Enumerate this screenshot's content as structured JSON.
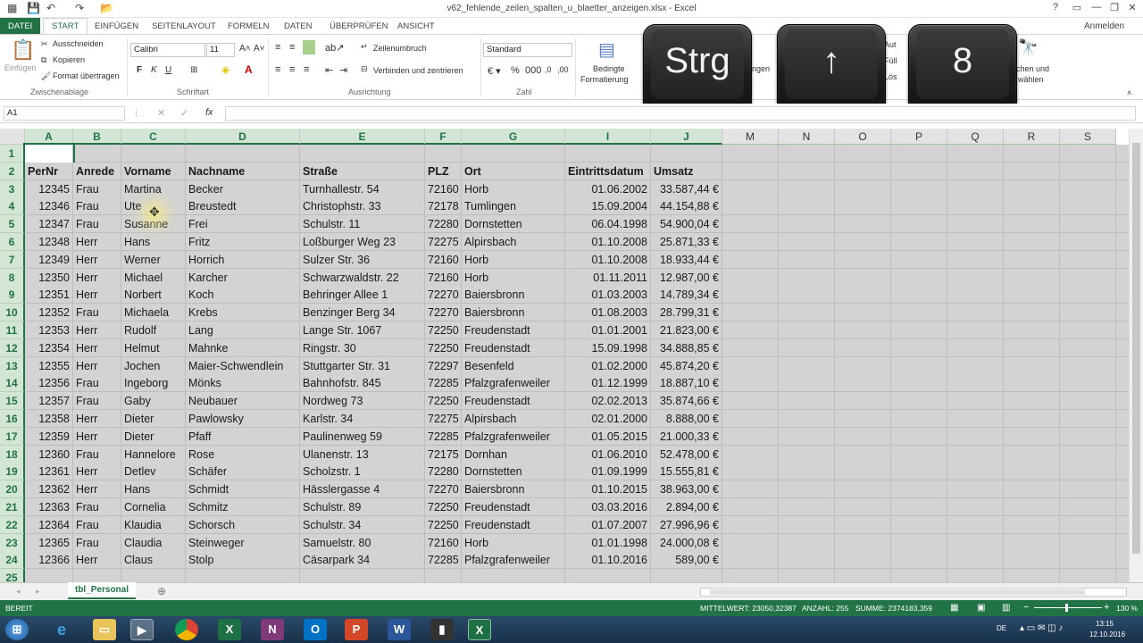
{
  "window": {
    "title": "v62_fehlende_zeilen_spalten_u_blaetter_anzeigen.xlsx - Excel",
    "user": "Anmelden",
    "help": "?",
    "minimize": "—",
    "restore": "❐",
    "close": "✕"
  },
  "tabs": [
    "DATEI",
    "START",
    "EINFÜGEN",
    "SEITENLAYOUT",
    "FORMELN",
    "DATEN",
    "ÜBERPRÜFEN",
    "ANSICHT"
  ],
  "ribbon": {
    "clipboard": {
      "paste": "Einfügen",
      "cut": "Ausschneiden",
      "copy": "Kopieren",
      "format_painter": "Format übertragen",
      "label": "Zwischenablage"
    },
    "font": {
      "name": "Calibri",
      "size": "11",
      "bold": "F",
      "italic": "K",
      "underline": "U",
      "label": "Schriftart"
    },
    "alignment": {
      "wrap": "Zeilenumbruch",
      "merge": "Verbinden und zentrieren",
      "label": "Ausrichtung"
    },
    "number": {
      "format": "Standard",
      "label": "Zahl"
    },
    "styles": {
      "conditional": "Bedingte",
      "conditional2": "Formatierung",
      "partial": "ngen"
    },
    "editing": {
      "autosum": "Aut",
      "fill": "Füll",
      "clear": "Lös",
      "find": "chen und",
      "find2": "wählen"
    }
  },
  "keys": [
    "Strg",
    "↑",
    "8"
  ],
  "formula_bar": {
    "name_box": "A1",
    "fx": "fx"
  },
  "columns": [
    {
      "id": "A",
      "w": 54
    },
    {
      "id": "B",
      "w": 54
    },
    {
      "id": "C",
      "w": 72
    },
    {
      "id": "D",
      "w": 128
    },
    {
      "id": "E",
      "w": 140
    },
    {
      "id": "F",
      "w": 41
    },
    {
      "id": "G",
      "w": 116
    },
    {
      "id": "I",
      "w": 96
    },
    {
      "id": "J",
      "w": 80
    },
    {
      "id": "M",
      "w": 63
    },
    {
      "id": "N",
      "w": 63
    },
    {
      "id": "O",
      "w": 63
    },
    {
      "id": "P",
      "w": 63
    },
    {
      "id": "Q",
      "w": 63
    },
    {
      "id": "R",
      "w": 63
    },
    {
      "id": "S",
      "w": 63
    }
  ],
  "header_row": [
    "PerNr",
    "Anrede",
    "Vorname",
    "Nachname",
    "Straße",
    "PLZ",
    "Ort",
    "Eintrittsdatum",
    "Umsatz"
  ],
  "rows": [
    [
      "12345",
      "Frau",
      "Martina",
      "Becker",
      "Turnhallestr. 54",
      "72160",
      "Horb",
      "01.06.2002",
      "33.587,44 €"
    ],
    [
      "12346",
      "Frau",
      "Ute",
      "Breustedt",
      "Christophstr. 33",
      "72178",
      "Tumlingen",
      "15.09.2004",
      "44.154,88 €"
    ],
    [
      "12347",
      "Frau",
      "Susanne",
      "Frei",
      "Schulstr. 11",
      "72280",
      "Dornstetten",
      "06.04.1998",
      "54.900,04 €"
    ],
    [
      "12348",
      "Herr",
      "Hans",
      "Fritz",
      "Loßburger Weg 23",
      "72275",
      "Alpirsbach",
      "01.10.2008",
      "25.871,33 €"
    ],
    [
      "12349",
      "Herr",
      "Werner",
      "Horrich",
      "Sulzer Str. 36",
      "72160",
      "Horb",
      "01.10.2008",
      "18.933,44 €"
    ],
    [
      "12350",
      "Herr",
      "Michael",
      "Karcher",
      "Schwarzwaldstr. 22",
      "72160",
      "Horb",
      "01.11.2011",
      "12.987,00 €"
    ],
    [
      "12351",
      "Herr",
      "Norbert",
      "Koch",
      "Behringer Allee 1",
      "72270",
      "Baiersbronn",
      "01.03.2003",
      "14.789,34 €"
    ],
    [
      "12352",
      "Frau",
      "Michaela",
      "Krebs",
      "Benzinger Berg 34",
      "72270",
      "Baiersbronn",
      "01.08.2003",
      "28.799,31 €"
    ],
    [
      "12353",
      "Herr",
      "Rudolf",
      "Lang",
      "Lange Str. 1067",
      "72250",
      "Freudenstadt",
      "01.01.2001",
      "21.823,00 €"
    ],
    [
      "12354",
      "Herr",
      "Helmut",
      "Mahnke",
      "Ringstr. 30",
      "72250",
      "Freudenstadt",
      "15.09.1998",
      "34.888,85 €"
    ],
    [
      "12355",
      "Herr",
      "Jochen",
      "Maier-Schwendlein",
      "Stuttgarter Str. 31",
      "72297",
      "Besenfeld",
      "01.02.2000",
      "45.874,20 €"
    ],
    [
      "12356",
      "Frau",
      "Ingeborg",
      "Mönks",
      "Bahnhofstr. 845",
      "72285",
      "Pfalzgrafenweiler",
      "01.12.1999",
      "18.887,10 €"
    ],
    [
      "12357",
      "Frau",
      "Gaby",
      "Neubauer",
      "Nordweg 73",
      "72250",
      "Freudenstadt",
      "02.02.2013",
      "35.874,66 €"
    ],
    [
      "12358",
      "Herr",
      "Dieter",
      "Pawlowsky",
      "Karlstr. 34",
      "72275",
      "Alpirsbach",
      "02.01.2000",
      "8.888,00 €"
    ],
    [
      "12359",
      "Herr",
      "Dieter",
      "Pfaff",
      "Paulinenweg 59",
      "72285",
      "Pfalzgrafenweiler",
      "01.05.2015",
      "21.000,33 €"
    ],
    [
      "12360",
      "Frau",
      "Hannelore",
      "Rose",
      "Ulanenstr. 13",
      "72175",
      "Dornhan",
      "01.06.2010",
      "52.478,00 €"
    ],
    [
      "12361",
      "Herr",
      "Detlev",
      "Schäfer",
      "Scholzstr. 1",
      "72280",
      "Dornstetten",
      "01.09.1999",
      "15.555,81 €"
    ],
    [
      "12362",
      "Herr",
      "Hans",
      "Schmidt",
      "Hässlergasse 4",
      "72270",
      "Baiersbronn",
      "01.10.2015",
      "38.963,00 €"
    ],
    [
      "12363",
      "Frau",
      "Cornelia",
      "Schmitz",
      "Schulstr. 89",
      "72250",
      "Freudenstadt",
      "03.03.2016",
      "2.894,00 €"
    ],
    [
      "12364",
      "Frau",
      "Klaudia",
      "Schorsch",
      "Schulstr. 34",
      "72250",
      "Freudenstadt",
      "01.07.2007",
      "27.996,96 €"
    ],
    [
      "12365",
      "Frau",
      "Claudia",
      "Steinweger",
      "Samuelstr. 80",
      "72160",
      "Horb",
      "01.01.1998",
      "24.000,08 €"
    ],
    [
      "12366",
      "Herr",
      "Claus",
      "Stolp",
      "Cäsarpark 34",
      "72285",
      "Pfalzgrafenweiler",
      "01.10.2016",
      "589,00 €"
    ]
  ],
  "row_numbers": [
    "1",
    "2",
    "3",
    "4",
    "5",
    "6",
    "7",
    "8",
    "9",
    "10",
    "11",
    "12",
    "13",
    "14",
    "15",
    "16",
    "17",
    "18",
    "19",
    "20",
    "21",
    "22",
    "23",
    "24",
    "25"
  ],
  "sheet_tab": "tbl_Personal",
  "add_sheet": "⊕",
  "status": {
    "mode": "BEREIT",
    "average": "MITTELWERT: 23050,32387",
    "count": "ANZAHL: 255",
    "sum": "SUMME: 2374183,359",
    "zoom": "130 %"
  },
  "taskbar": {
    "lang": "DE",
    "time": "13:15",
    "date": "12.10.2016"
  },
  "colors": {
    "accent": "#217346",
    "selection": "#d3d3d3",
    "header_sel": "#d3e6d5"
  }
}
